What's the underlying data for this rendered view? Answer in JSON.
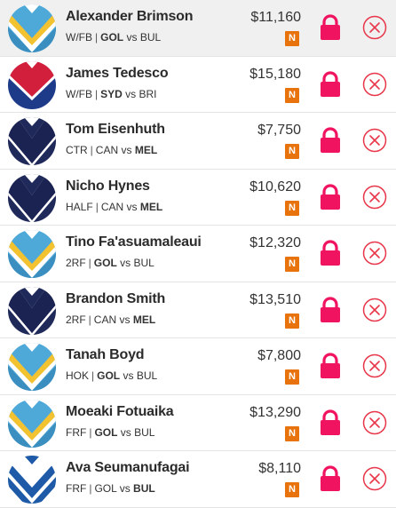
{
  "colors": {
    "lock": "#f0135f",
    "remove": "#e8364a",
    "badge": "#e8720c"
  },
  "players": [
    {
      "name": "Alexander Brimson",
      "pos": "W/FB",
      "team": "GOL",
      "opp": "BUL",
      "bold": "team",
      "price": "$11,160",
      "badge": "N",
      "jersey": "gol"
    },
    {
      "name": "James Tedesco",
      "pos": "W/FB",
      "team": "SYD",
      "opp": "BRI",
      "bold": "team",
      "price": "$15,180",
      "badge": "N",
      "jersey": "syd"
    },
    {
      "name": "Tom Eisenhuth",
      "pos": "CTR",
      "team": "CAN",
      "opp": "MEL",
      "bold": "opp",
      "price": "$7,750",
      "badge": "N",
      "jersey": "mel"
    },
    {
      "name": "Nicho Hynes",
      "pos": "HALF",
      "team": "CAN",
      "opp": "MEL",
      "bold": "opp",
      "price": "$10,620",
      "badge": "N",
      "jersey": "mel"
    },
    {
      "name": "Tino Fa'asuamaleaui",
      "pos": "2RF",
      "team": "GOL",
      "opp": "BUL",
      "bold": "team",
      "price": "$12,320",
      "badge": "N",
      "jersey": "gol"
    },
    {
      "name": "Brandon Smith",
      "pos": "2RF",
      "team": "CAN",
      "opp": "MEL",
      "bold": "opp",
      "price": "$13,510",
      "badge": "N",
      "jersey": "mel"
    },
    {
      "name": "Tanah Boyd",
      "pos": "HOK",
      "team": "GOL",
      "opp": "BUL",
      "bold": "team",
      "price": "$7,800",
      "badge": "N",
      "jersey": "gol"
    },
    {
      "name": "Moeaki Fotuaika",
      "pos": "FRF",
      "team": "GOL",
      "opp": "BUL",
      "bold": "team",
      "price": "$13,290",
      "badge": "N",
      "jersey": "gol"
    },
    {
      "name": "Ava Seumanufagai",
      "pos": "FRF",
      "team": "GOL",
      "opp": "BUL",
      "bold": "opp",
      "price": "$8,110",
      "badge": "N",
      "jersey": "bul"
    }
  ],
  "sub_vs": "vs",
  "icons": {
    "lock": "lock-icon",
    "remove": "remove-circle-x-icon"
  }
}
